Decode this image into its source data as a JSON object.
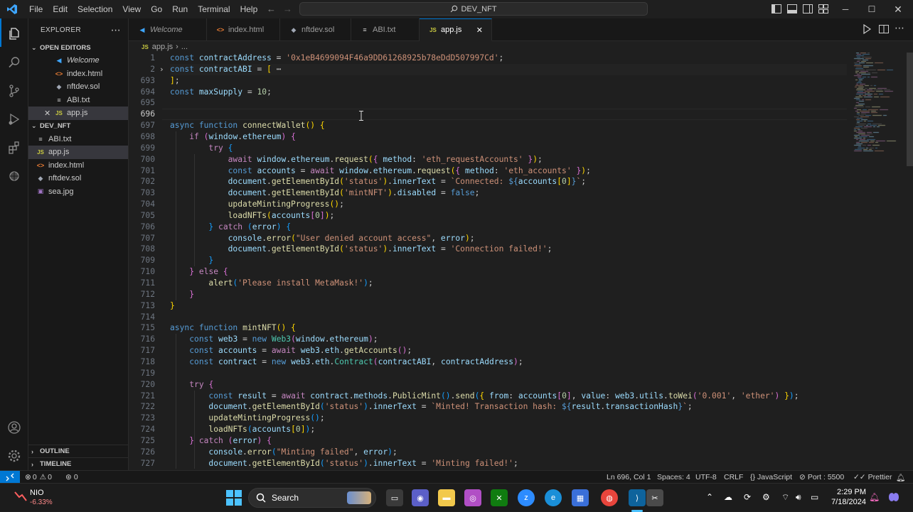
{
  "menu": [
    "File",
    "Edit",
    "Selection",
    "View",
    "Go",
    "Run",
    "Terminal",
    "Help"
  ],
  "command_center": "DEV_NFT",
  "sidebar": {
    "title": "EXPLORER",
    "open_editors_label": "OPEN EDITORS",
    "open_editors": [
      {
        "name": "Welcome",
        "icon": "vscode-icon",
        "italic": true
      },
      {
        "name": "index.html",
        "icon": "html-icon"
      },
      {
        "name": "nftdev.sol",
        "icon": "solidity-icon"
      },
      {
        "name": "ABI.txt",
        "icon": "text-icon"
      },
      {
        "name": "app.js",
        "icon": "js-icon",
        "modified_close": true
      }
    ],
    "project_label": "DEV_NFT",
    "files": [
      "ABI.txt",
      "app.js",
      "index.html",
      "nftdev.sol",
      "sea.jpg"
    ],
    "outline_label": "OUTLINE",
    "timeline_label": "TIMELINE"
  },
  "tabs": [
    {
      "label": "Welcome",
      "icon": "vscode-icon"
    },
    {
      "label": "index.html",
      "icon": "html-icon"
    },
    {
      "label": "nftdev.sol",
      "icon": "solidity-icon"
    },
    {
      "label": "ABI.txt",
      "icon": "text-icon"
    },
    {
      "label": "app.js",
      "icon": "js-icon",
      "active": true
    }
  ],
  "breadcrumb": {
    "file": "app.js",
    "rest": "..."
  },
  "code_lines": [
    {
      "n": "1",
      "html": "<span class=\"k\">const</span> <span class=\"v\">contractAddress</span> = <span class=\"s\">'0x1eB4699094F46a9DD61268925b78eDdD507997Cd'</span>;"
    },
    {
      "n": "2",
      "html": "<span class=\"k\">const</span> <span class=\"v\">contractABI</span> = <span class=\"y\">[</span> <span class=\"p\">⋯</span>",
      "fold": true
    },
    {
      "n": "693",
      "html": "<span class=\"y\">]</span>;"
    },
    {
      "n": "694",
      "html": "<span class=\"k\">const</span> <span class=\"v\">maxSupply</span> = <span class=\"n\">10</span>;"
    },
    {
      "n": "695",
      "html": ""
    },
    {
      "n": "696",
      "html": "",
      "current": true
    },
    {
      "n": "697",
      "html": "<span class=\"k\">async</span> <span class=\"k\">function</span> <span class=\"f\">connectWallet</span><span class=\"y\">()</span> <span class=\"y\">{</span>"
    },
    {
      "n": "698",
      "html": "    <span class=\"kc\">if</span> <span class=\"pk\">(</span><span class=\"v\">window</span>.<span class=\"v\">ethereum</span><span class=\"pk\">)</span> <span class=\"pk\">{</span>"
    },
    {
      "n": "699",
      "html": "        <span class=\"kc\">try</span> <span class=\"bl\">{</span>"
    },
    {
      "n": "700",
      "html": "            <span class=\"kc\">await</span> <span class=\"v\">window</span>.<span class=\"v\">ethereum</span>.<span class=\"f\">request</span><span class=\"y\">(</span><span class=\"pk\">{</span> <span class=\"v\">method</span>: <span class=\"s\">'eth_requestAccounts'</span> <span class=\"pk\">}</span><span class=\"y\">)</span>;"
    },
    {
      "n": "701",
      "html": "            <span class=\"k\">const</span> <span class=\"v\">accounts</span> = <span class=\"kc\">await</span> <span class=\"v\">window</span>.<span class=\"v\">ethereum</span>.<span class=\"f\">request</span><span class=\"y\">(</span><span class=\"pk\">{</span> <span class=\"v\">method</span>: <span class=\"s\">'eth_accounts'</span> <span class=\"pk\">}</span><span class=\"y\">)</span>;"
    },
    {
      "n": "702",
      "html": "            <span class=\"v\">document</span>.<span class=\"f\">getElementById</span><span class=\"y\">(</span><span class=\"s\">'status'</span><span class=\"y\">)</span>.<span class=\"v\">innerText</span> = <span class=\"s\">`Connected: </span><span class=\"k\">${</span><span class=\"v\">accounts</span><span class=\"y\">[</span><span class=\"n\">0</span><span class=\"y\">]</span><span class=\"k\">}</span><span class=\"s\">`</span>;"
    },
    {
      "n": "703",
      "html": "            <span class=\"v\">document</span>.<span class=\"f\">getElementById</span><span class=\"y\">(</span><span class=\"s\">'mintNFT'</span><span class=\"y\">)</span>.<span class=\"v\">disabled</span> = <span class=\"k\">false</span>;"
    },
    {
      "n": "704",
      "html": "            <span class=\"f\">updateMintingProgress</span><span class=\"y\">()</span>;"
    },
    {
      "n": "705",
      "html": "            <span class=\"f\">loadNFTs</span><span class=\"y\">(</span><span class=\"v\">accounts</span><span class=\"pk\">[</span><span class=\"n\">0</span><span class=\"pk\">]</span><span class=\"y\">)</span>;"
    },
    {
      "n": "706",
      "html": "        <span class=\"bl\">}</span> <span class=\"kc\">catch</span> <span class=\"bl\">(</span><span class=\"v\">error</span><span class=\"bl\">)</span> <span class=\"bl\">{</span>"
    },
    {
      "n": "707",
      "html": "            <span class=\"v\">console</span>.<span class=\"f\">error</span><span class=\"y\">(</span><span class=\"s\">\"User denied account access\"</span>, <span class=\"v\">error</span><span class=\"y\">)</span>;"
    },
    {
      "n": "708",
      "html": "            <span class=\"v\">document</span>.<span class=\"f\">getElementById</span><span class=\"y\">(</span><span class=\"s\">'status'</span><span class=\"y\">)</span>.<span class=\"v\">innerText</span> = <span class=\"s\">'Connection failed!'</span>;"
    },
    {
      "n": "709",
      "html": "        <span class=\"bl\">}</span>"
    },
    {
      "n": "710",
      "html": "    <span class=\"pk\">}</span> <span class=\"kc\">else</span> <span class=\"pk\">{</span>"
    },
    {
      "n": "711",
      "html": "        <span class=\"f\">alert</span><span class=\"bl\">(</span><span class=\"s\">'Please install MetaMask!'</span><span class=\"bl\">)</span>;"
    },
    {
      "n": "712",
      "html": "    <span class=\"pk\">}</span>"
    },
    {
      "n": "713",
      "html": "<span class=\"y\">}</span>"
    },
    {
      "n": "714",
      "html": ""
    },
    {
      "n": "715",
      "html": "<span class=\"k\">async</span> <span class=\"k\">function</span> <span class=\"f\">mintNFT</span><span class=\"y\">()</span> <span class=\"y\">{</span>"
    },
    {
      "n": "716",
      "html": "    <span class=\"k\">const</span> <span class=\"v\">web3</span> = <span class=\"k\">new</span> <span class=\"c\">Web3</span><span class=\"pk\">(</span><span class=\"v\">window</span>.<span class=\"v\">ethereum</span><span class=\"pk\">)</span>;"
    },
    {
      "n": "717",
      "html": "    <span class=\"k\">const</span> <span class=\"v\">accounts</span> = <span class=\"kc\">await</span> <span class=\"v\">web3</span>.<span class=\"v\">eth</span>.<span class=\"f\">getAccounts</span><span class=\"pk\">()</span>;"
    },
    {
      "n": "718",
      "html": "    <span class=\"k\">const</span> <span class=\"v\">contract</span> = <span class=\"k\">new</span> <span class=\"v\">web3</span>.<span class=\"v\">eth</span>.<span class=\"c\">Contract</span><span class=\"pk\">(</span><span class=\"v\">contractABI</span>, <span class=\"v\">contractAddress</span><span class=\"pk\">)</span>;"
    },
    {
      "n": "719",
      "html": ""
    },
    {
      "n": "720",
      "html": "    <span class=\"kc\">try</span> <span class=\"pk\">{</span>"
    },
    {
      "n": "721",
      "html": "        <span class=\"k\">const</span> <span class=\"v\">result</span> = <span class=\"kc\">await</span> <span class=\"v\">contract</span>.<span class=\"v\">methods</span>.<span class=\"f\">PublicMint</span><span class=\"bl\">()</span>.<span class=\"f\">send</span><span class=\"bl\">(</span><span class=\"y\">{</span> <span class=\"v\">from</span>: <span class=\"v\">accounts</span><span class=\"pk\">[</span><span class=\"n\">0</span><span class=\"pk\">]</span>, <span class=\"v\">value</span>: <span class=\"v\">web3</span>.<span class=\"v\">utils</span>.<span class=\"f\">toWei</span><span class=\"pk\">(</span><span class=\"s\">'0.001'</span>, <span class=\"s\">'ether'</span><span class=\"pk\">)</span> <span class=\"y\">}</span><span class=\"bl\">)</span>;"
    },
    {
      "n": "722",
      "html": "        <span class=\"v\">document</span>.<span class=\"f\">getElementById</span><span class=\"bl\">(</span><span class=\"s\">'status'</span><span class=\"bl\">)</span>.<span class=\"v\">innerText</span> = <span class=\"s\">`Minted! Transaction hash: </span><span class=\"k\">${</span><span class=\"v\">result</span>.<span class=\"v\">transactionHash</span><span class=\"k\">}</span><span class=\"s\">`</span>;"
    },
    {
      "n": "723",
      "html": "        <span class=\"f\">updateMintingProgress</span><span class=\"bl\">()</span>;"
    },
    {
      "n": "724",
      "html": "        <span class=\"f\">loadNFTs</span><span class=\"bl\">(</span><span class=\"v\">accounts</span><span class=\"y\">[</span><span class=\"n\">0</span><span class=\"y\">]</span><span class=\"bl\">)</span>;"
    },
    {
      "n": "725",
      "html": "    <span class=\"pk\">}</span> <span class=\"kc\">catch</span> <span class=\"pk\">(</span><span class=\"v\">error</span><span class=\"pk\">)</span> <span class=\"pk\">{</span>"
    },
    {
      "n": "726",
      "html": "        <span class=\"v\">console</span>.<span class=\"f\">error</span><span class=\"bl\">(</span><span class=\"s\">\"Minting failed\"</span>, <span class=\"v\">error</span><span class=\"bl\">)</span>;"
    },
    {
      "n": "727",
      "html": "        <span class=\"v\">document</span>.<span class=\"f\">getElementById</span><span class=\"bl\">(</span><span class=\"s\">'status'</span><span class=\"bl\">)</span>.<span class=\"v\">innerText</span> = <span class=\"s\">'Minting failed!'</span>;"
    }
  ],
  "statusbar": {
    "errors": "0",
    "warnings": "0",
    "ports": "0",
    "position": "Ln 696, Col 1",
    "spaces": "Spaces: 4",
    "encoding": "UTF-8",
    "eol": "CRLF",
    "language": "JavaScript",
    "port": "Port : 5500",
    "prettier": "Prettier"
  },
  "taskbar": {
    "stock_name": "NIO",
    "stock_change": "-6.33%",
    "search_label": "Search",
    "time": "2:29 PM",
    "date": "7/18/2024"
  },
  "colors": {
    "accent": "#0078d4",
    "editor_bg": "#1f1f1f",
    "sidebar_bg": "#181818",
    "stock_down": "#ff5f5f"
  }
}
